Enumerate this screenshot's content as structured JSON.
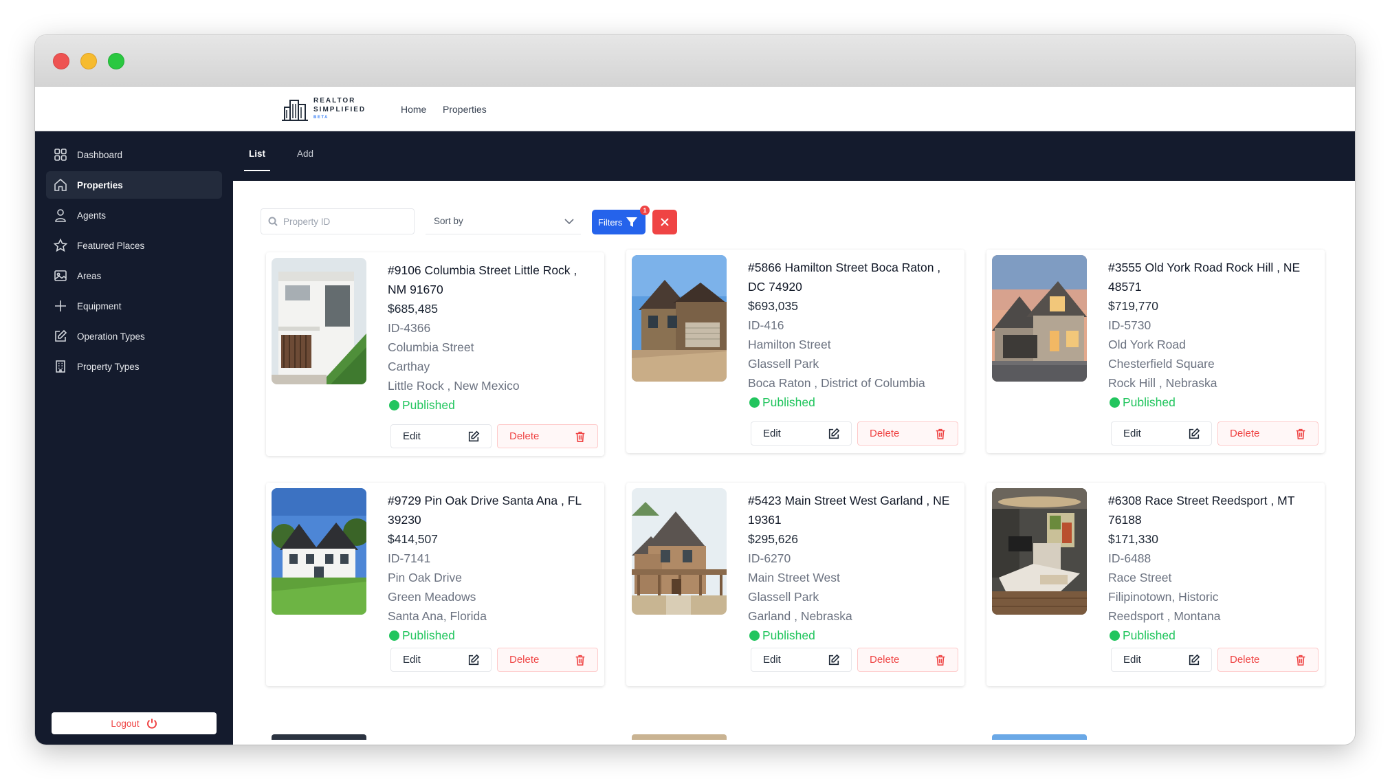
{
  "brand": {
    "line1": "REALTOR",
    "line2": "SIMPLIFIED",
    "badge": "BETA"
  },
  "topnav": {
    "home": "Home",
    "properties": "Properties"
  },
  "sidebar": {
    "items": [
      {
        "label": "Dashboard",
        "icon": "grid-icon"
      },
      {
        "label": "Properties",
        "icon": "home-icon",
        "active": true
      },
      {
        "label": "Agents",
        "icon": "user-icon"
      },
      {
        "label": "Featured Places",
        "icon": "star-icon"
      },
      {
        "label": "Areas",
        "icon": "image-icon"
      },
      {
        "label": "Equipment",
        "icon": "plus-icon"
      },
      {
        "label": "Operation Types",
        "icon": "edit-icon"
      },
      {
        "label": "Property Types",
        "icon": "building-icon"
      }
    ],
    "logout": "Logout"
  },
  "tabs": {
    "list": "List",
    "add": "Add"
  },
  "toolbar": {
    "search_placeholder": "Property ID",
    "sort_label": "Sort by",
    "filters_label": "Filters",
    "filters_count": "1"
  },
  "cards": [
    {
      "title": "#9106 Columbia Street Little Rock , NM 91670",
      "price": "$685,485",
      "id": "ID-4366",
      "street": "Columbia Street",
      "neighborhood": "Carthay",
      "city": "Little Rock , New Mexico",
      "status": "Published",
      "edit": "Edit",
      "delete": "Delete"
    },
    {
      "title": "#5866 Hamilton Street Boca Raton , DC 74920",
      "price": "$693,035",
      "id": "ID-416",
      "street": "Hamilton Street",
      "neighborhood": "Glassell Park",
      "city": "Boca Raton , District of Columbia",
      "status": "Published",
      "edit": "Edit",
      "delete": "Delete"
    },
    {
      "title": "#3555 Old York Road Rock Hill , NE 48571",
      "price": "$719,770",
      "id": "ID-5730",
      "street": "Old York Road",
      "neighborhood": "Chesterfield Square",
      "city": "Rock Hill , Nebraska",
      "status": "Published",
      "edit": "Edit",
      "delete": "Delete"
    },
    {
      "title": "#9729 Pin Oak Drive Santa Ana , FL 39230",
      "price": "$414,507",
      "id": "ID-7141",
      "street": "Pin Oak Drive",
      "neighborhood": "Green Meadows",
      "city": "Santa Ana, Florida",
      "status": "Published",
      "edit": "Edit",
      "delete": "Delete"
    },
    {
      "title": "#5423 Main Street West Garland , NE 19361",
      "price": "$295,626",
      "id": "ID-6270",
      "street": "Main Street West",
      "neighborhood": "Glassell Park",
      "city": "Garland , Nebraska",
      "status": "Published",
      "edit": "Edit",
      "delete": "Delete"
    },
    {
      "title": "#6308 Race Street Reedsport , MT 76188",
      "price": "$171,330",
      "id": "ID-6488",
      "street": "Race Street",
      "neighborhood": "Filipinotown, Historic",
      "city": "Reedsport , Montana",
      "status": "Published",
      "edit": "Edit",
      "delete": "Delete"
    }
  ],
  "colors": {
    "sidebar_bg": "#141b2d",
    "primary": "#2563eb",
    "danger": "#ef4444",
    "success": "#22c55e"
  }
}
